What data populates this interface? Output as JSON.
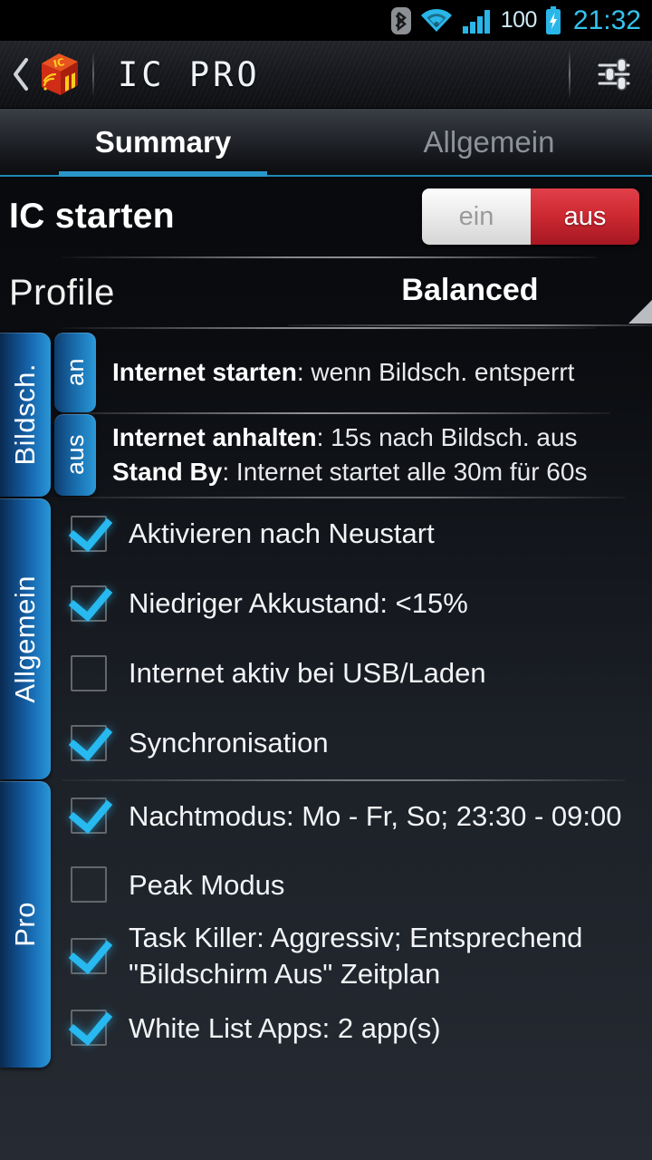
{
  "statusbar": {
    "bluetooth_icon": "bluetooth-icon",
    "wifi_icon": "wifi-icon",
    "signal_icon": "cellular-signal-icon",
    "battery_level": "100",
    "battery_icon": "battery-charging-icon",
    "clock": "21:32"
  },
  "titlebar": {
    "back_icon": "back-chevron-icon",
    "logo_icon": "ic-pro-cube-logo",
    "title": "IC PRO",
    "settings_icon": "settings-sliders-icon"
  },
  "tabs": [
    {
      "label": "Summary",
      "active": true
    },
    {
      "label": "Allgemein",
      "active": false
    }
  ],
  "start_row": {
    "label": "IC starten",
    "toggle": {
      "on_label": "ein",
      "off_label": "aus",
      "selected": "aus"
    }
  },
  "profile_row": {
    "label": "Profile",
    "value": "Balanced",
    "arrow_icon": "spinner-triangle-icon"
  },
  "screen_section": {
    "side_tab": "Bildsch.",
    "blocks": [
      {
        "state_tab": "an",
        "lines": [
          {
            "bold": "Internet starten",
            "rest": ": wenn Bildsch. entsperrt"
          }
        ]
      },
      {
        "state_tab": "aus",
        "lines": [
          {
            "bold": "Internet anhalten",
            "rest": ": 15s nach Bildsch. aus"
          },
          {
            "bold": "Stand By",
            "rest": ": Internet startet alle 30m für 60s"
          }
        ]
      }
    ]
  },
  "general_section": {
    "side_tab": "Allgemein",
    "items": [
      {
        "label": "Aktivieren nach Neustart",
        "checked": true
      },
      {
        "label": "Niedriger Akkustand: <15%",
        "checked": true
      },
      {
        "label": "Internet aktiv bei USB/Laden",
        "checked": false
      },
      {
        "label": "Synchronisation",
        "checked": true
      }
    ]
  },
  "pro_section": {
    "side_tab": "Pro",
    "items": [
      {
        "label": "Nachtmodus: Mo - Fr, So; 23:30 - 09:00",
        "checked": true,
        "tall": false
      },
      {
        "label": "Peak Modus",
        "checked": false,
        "tall": false
      },
      {
        "label": "Task Killer: Aggressiv; Entsprechend \"Bildschirm Aus\" Zeitplan",
        "checked": true,
        "tall": true
      },
      {
        "label": "White List Apps: 2 app(s)",
        "checked": true,
        "tall": false
      }
    ]
  },
  "colors": {
    "accent_cyan": "#27b9f0",
    "tab_underline": "#2a96c9",
    "toggle_red": "#cf2a33",
    "side_tab_blue": "#1b76bd",
    "status_clock": "#34c3ee"
  }
}
